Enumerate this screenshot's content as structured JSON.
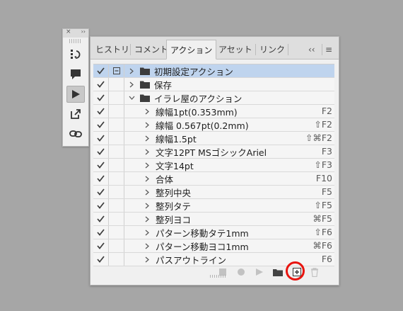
{
  "dock": {
    "close_glyph": "×",
    "collapse_glyph": "››",
    "buttons": [
      {
        "name": "history-icon"
      },
      {
        "name": "comment-icon"
      },
      {
        "name": "play-icon",
        "active": true
      },
      {
        "name": "export-icon"
      },
      {
        "name": "link-icon"
      }
    ]
  },
  "tabs": [
    "ヒストリ",
    "コメント",
    "アクション",
    "アセット",
    "リンク"
  ],
  "active_tab": "アクション",
  "tab_controls": {
    "collapse": "‹‹",
    "menu": "≡"
  },
  "rows": [
    {
      "level": 0,
      "type": "set",
      "expanded": false,
      "label": "初期設定アクション",
      "key": "",
      "checked": true,
      "dialog": true,
      "selected": true
    },
    {
      "level": 0,
      "type": "set",
      "expanded": false,
      "label": "保存",
      "key": "",
      "checked": true,
      "dialog": false,
      "selected": false
    },
    {
      "level": 0,
      "type": "set",
      "expanded": true,
      "label": "イラレ屋のアクション",
      "key": "",
      "checked": true,
      "dialog": false,
      "selected": false
    },
    {
      "level": 1,
      "type": "action",
      "label": "線幅1pt(0.353mm)",
      "key": "F2",
      "checked": true
    },
    {
      "level": 1,
      "type": "action",
      "label": "線幅 0.567pt(0.2mm)",
      "key": "⇧F2",
      "checked": true
    },
    {
      "level": 1,
      "type": "action",
      "label": "線幅1.5pt",
      "key": "⇧⌘F2",
      "checked": true
    },
    {
      "level": 1,
      "type": "action",
      "label": "文字12PT MSゴシックAriel",
      "key": "F3",
      "checked": true
    },
    {
      "level": 1,
      "type": "action",
      "label": "文字14pt",
      "key": "⇧F3",
      "checked": true
    },
    {
      "level": 1,
      "type": "action",
      "label": "合体",
      "key": "F10",
      "checked": true
    },
    {
      "level": 1,
      "type": "action",
      "label": "整列中央",
      "key": "F5",
      "checked": true
    },
    {
      "level": 1,
      "type": "action",
      "label": "整列タテ",
      "key": "⇧F5",
      "checked": true
    },
    {
      "level": 1,
      "type": "action",
      "label": "整列ヨコ",
      "key": "⌘F5",
      "checked": true
    },
    {
      "level": 1,
      "type": "action",
      "label": "パターン移動タテ1mm",
      "key": "⇧F6",
      "checked": true
    },
    {
      "level": 1,
      "type": "action",
      "label": "パターン移動ヨコ1mm",
      "key": "⌘F6",
      "checked": true
    },
    {
      "level": 1,
      "type": "action",
      "label": "パスアウトライン",
      "key": "F6",
      "checked": true
    }
  ],
  "bottom_buttons": [
    "stop-icon",
    "record-icon",
    "play-selection-icon",
    "new-set-icon",
    "new-action-icon",
    "delete-icon"
  ],
  "colors": {
    "selected_row": "#bfd4ee",
    "highlight": "#e8140f",
    "background": "#a6a6a6"
  }
}
